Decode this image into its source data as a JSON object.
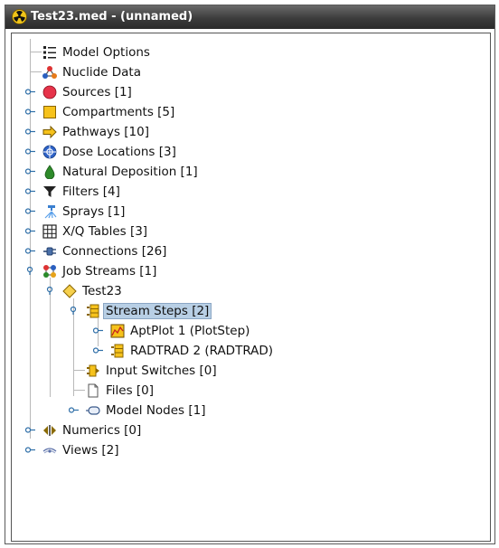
{
  "window": {
    "title": "Test23.med - (unnamed)",
    "icon": "radiation-icon"
  },
  "tree": {
    "items": [
      {
        "label": "Model Options",
        "icon": "list-icon"
      },
      {
        "label": "Nuclide Data",
        "icon": "molecule-icon"
      },
      {
        "label": "Sources [1]",
        "icon": "red-circle-icon"
      },
      {
        "label": "Compartments [5]",
        "icon": "yellow-square-icon"
      },
      {
        "label": "Pathways [10]",
        "icon": "arrow-right-icon"
      },
      {
        "label": "Dose Locations [3]",
        "icon": "crosshair-icon"
      },
      {
        "label": "Natural Deposition [1]",
        "icon": "drop-icon"
      },
      {
        "label": "Filters [4]",
        "icon": "filter-icon"
      },
      {
        "label": "Sprays [1]",
        "icon": "spray-icon"
      },
      {
        "label": "X/Q Tables [3]",
        "icon": "grid-icon"
      },
      {
        "label": "Connections [26]",
        "icon": "plug-icon"
      },
      {
        "label": "Job Streams [1]",
        "icon": "network-icon"
      },
      {
        "label": "Test23",
        "icon": "diamond-icon"
      },
      {
        "label": "Stream Steps [2]",
        "icon": "steps-icon",
        "selected": true
      },
      {
        "label": "AptPlot 1 (PlotStep)",
        "icon": "plot-icon"
      },
      {
        "label": "RADTRAD 2 (RADTRAD)",
        "icon": "steps-icon"
      },
      {
        "label": "Input Switches [0]",
        "icon": "switch-icon"
      },
      {
        "label": "Files [0]",
        "icon": "file-icon"
      },
      {
        "label": "Model Nodes [1]",
        "icon": "node-icon"
      },
      {
        "label": "Numerics [0]",
        "icon": "numerics-icon"
      },
      {
        "label": "Views [2]",
        "icon": "eye-icon"
      }
    ]
  },
  "colors": {
    "selection": "#b8cfe5",
    "titlebar": "#3c3c3c"
  }
}
